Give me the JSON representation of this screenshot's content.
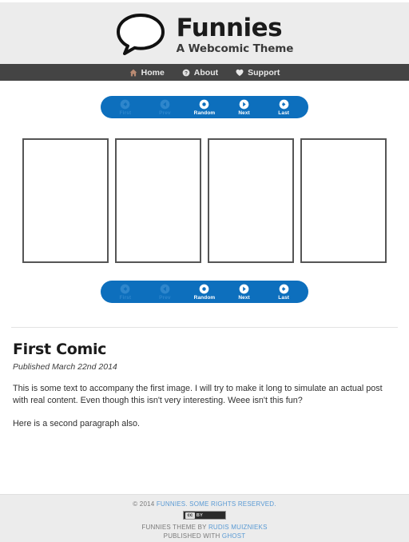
{
  "header": {
    "logo_icon": "speech-bubble-icon",
    "title": "Funnies",
    "tagline": "A Webcomic Theme"
  },
  "nav": {
    "items": [
      {
        "label": "Home",
        "icon": "home-icon"
      },
      {
        "label": "About",
        "icon": "question-circle-icon"
      },
      {
        "label": "Support",
        "icon": "heart-icon"
      }
    ]
  },
  "comic_nav": {
    "buttons": [
      {
        "label": "First",
        "icon": "arrow-left-circle-icon",
        "disabled": true
      },
      {
        "label": "Prev",
        "icon": "chevron-left-circle-icon",
        "disabled": true
      },
      {
        "label": "Random",
        "icon": "dot-circle-icon",
        "disabled": false
      },
      {
        "label": "Next",
        "icon": "chevron-right-circle-icon",
        "disabled": false
      },
      {
        "label": "Last",
        "icon": "arrow-right-circle-icon",
        "disabled": false
      }
    ]
  },
  "comic": {
    "panel_count": 4,
    "panels": [
      {
        "alt": "comic-panel-1"
      },
      {
        "alt": "comic-panel-2"
      },
      {
        "alt": "comic-panel-3"
      },
      {
        "alt": "comic-panel-4"
      }
    ]
  },
  "post": {
    "title": "First Comic",
    "meta": "Published March 22nd 2014",
    "paragraphs": [
      "This is some text to accompany the first image. I will try to make it long to simulate an actual post with real content. Even though this isn't very interesting. Weee isn't this fun?",
      "Here is a second paragraph also."
    ]
  },
  "footer": {
    "copyright_prefix": "© 2014 ",
    "copyright_link": "FUNNIES. SOME RIGHTS RESERVED.",
    "cc_badge": {
      "mark": "cc",
      "by": "BY"
    },
    "theme_prefix": "FUNNIES THEME BY ",
    "theme_link": "RUDIS MUIZNIEKS",
    "published_prefix": "PUBLISHED WITH ",
    "published_link": "GHOST"
  },
  "colors": {
    "accent_blue": "#0d6fbd",
    "nav_dark": "#444444",
    "page_gray": "#ececec",
    "link_blue": "#5a9ad4",
    "panel_border": "#555555"
  }
}
